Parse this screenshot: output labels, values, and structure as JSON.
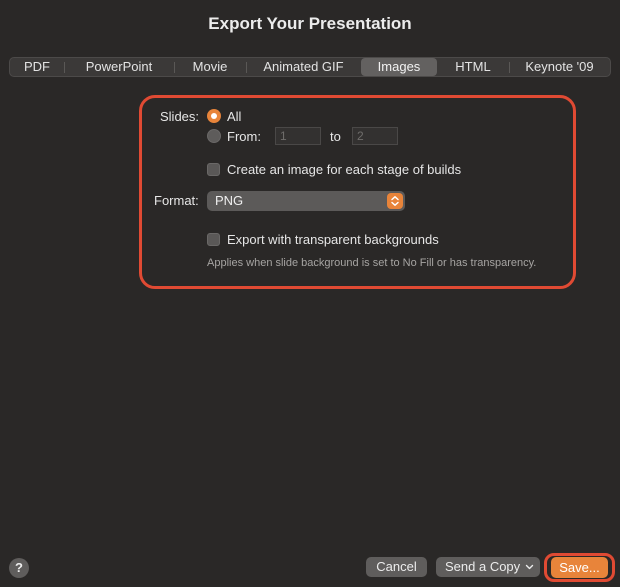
{
  "dialog": {
    "title": "Export Your Presentation"
  },
  "tabs": [
    {
      "label": "PDF",
      "active": false
    },
    {
      "label": "PowerPoint",
      "active": false
    },
    {
      "label": "Movie",
      "active": false
    },
    {
      "label": "Animated GIF",
      "active": false
    },
    {
      "label": "Images",
      "active": true
    },
    {
      "label": "HTML",
      "active": false
    },
    {
      "label": "Keynote '09",
      "active": false
    }
  ],
  "slides": {
    "label": "Slides:",
    "all_label": "All",
    "all_selected": true,
    "from_label": "From:",
    "from_value": "1",
    "to_label": "to",
    "to_value": "2"
  },
  "builds": {
    "label": "Create an image for each stage of builds",
    "checked": false
  },
  "format": {
    "label": "Format:",
    "value": "PNG"
  },
  "transparent": {
    "label": "Export with transparent backgrounds",
    "checked": false,
    "hint": "Applies when slide background is set to No Fill or has transparency."
  },
  "footer": {
    "help_label": "?",
    "cancel_label": "Cancel",
    "send_copy_label": "Send a Copy",
    "save_label": "Save..."
  },
  "colors": {
    "accent": "#e8843a",
    "highlight": "#e04a33",
    "background": "#2a2827"
  },
  "icons": {
    "stepper": "chevron-up-down-icon",
    "dropdown": "chevron-down-icon",
    "help": "question-icon"
  }
}
